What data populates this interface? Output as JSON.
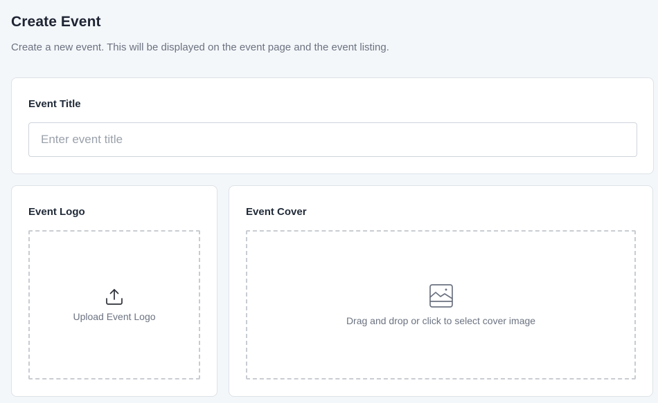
{
  "header": {
    "title": "Create Event",
    "subtitle": "Create a new event. This will be displayed on the event page and the event listing."
  },
  "title_section": {
    "label": "Event Title",
    "input_value": "",
    "input_placeholder": "Enter event title"
  },
  "logo_section": {
    "label": "Event Logo",
    "dropzone_text": "Upload Event Logo",
    "icon": "upload-icon"
  },
  "cover_section": {
    "label": "Event Cover",
    "dropzone_text": "Drag and drop or click to select cover image",
    "icon": "image-icon"
  },
  "colors": {
    "background": "#f4f7fa",
    "card": "#ffffff",
    "border": "#dde2e8",
    "text_primary": "#1f2937",
    "text_muted": "#6b7280"
  }
}
